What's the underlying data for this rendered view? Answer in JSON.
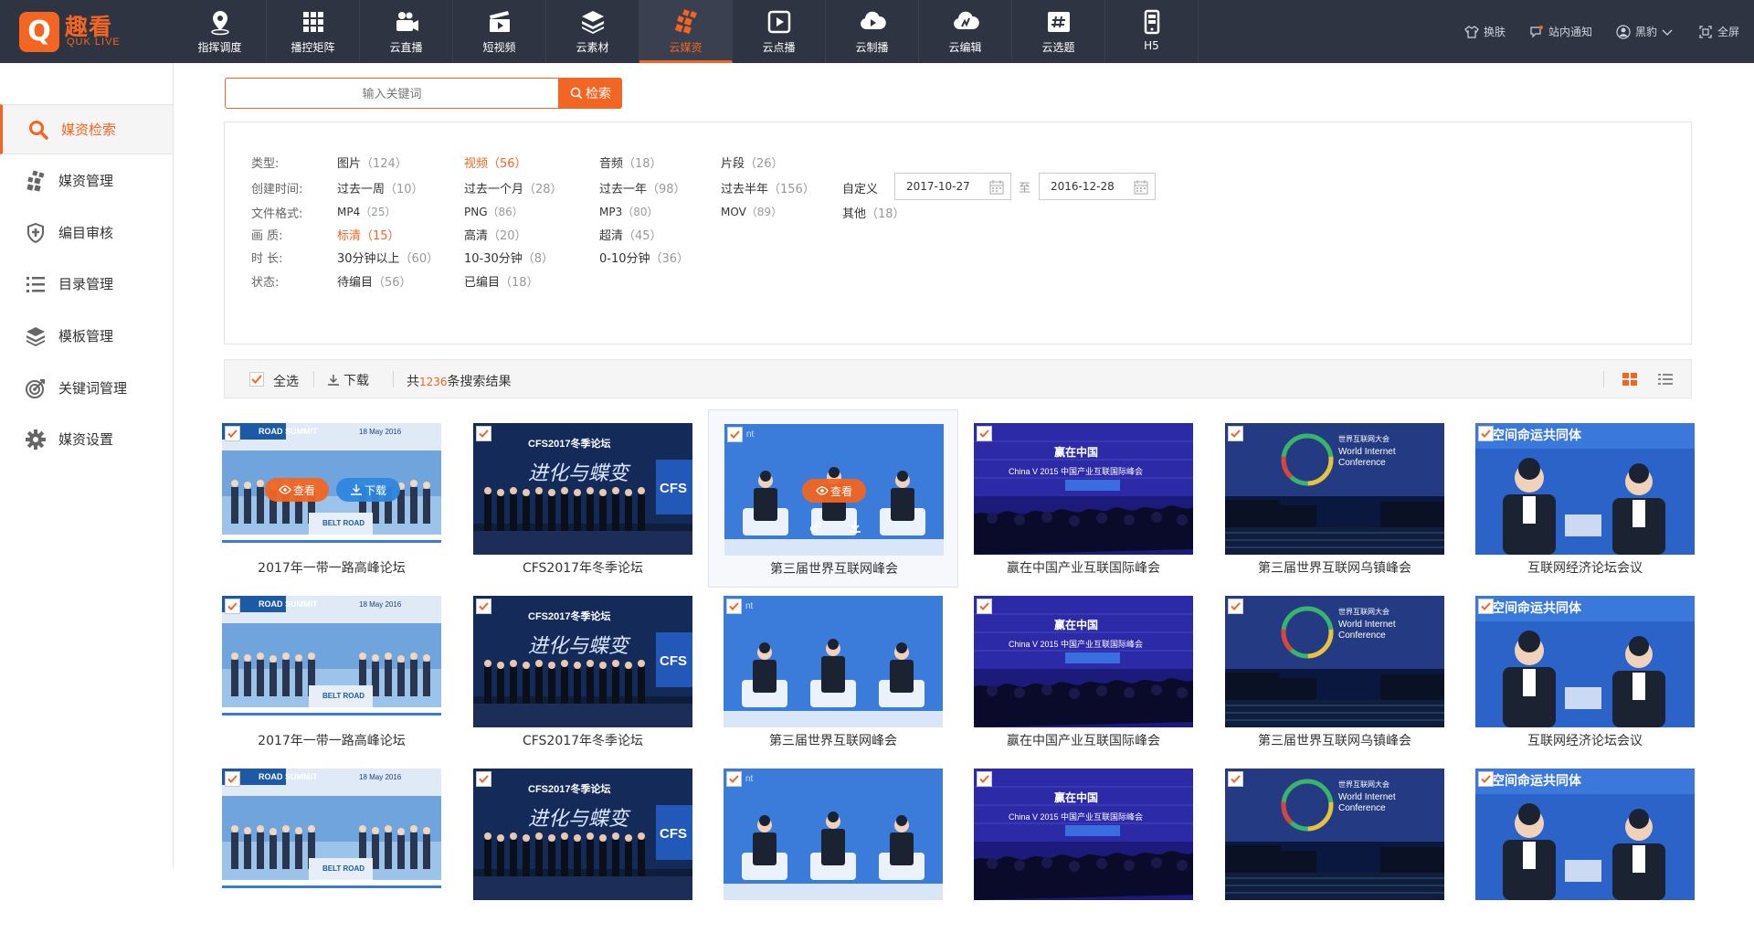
{
  "brand": {
    "logo_glyph": "Q",
    "name_cn": "趣看",
    "name_en": "QUK LIVE",
    "color": "#f26522"
  },
  "nav": [
    {
      "label": "指挥调度",
      "icon": "location-pin-icon"
    },
    {
      "label": "播控矩阵",
      "icon": "grid-icon"
    },
    {
      "label": "云直播",
      "icon": "camera-icon"
    },
    {
      "label": "短视频",
      "icon": "clapperboard-icon"
    },
    {
      "label": "云素材",
      "icon": "layers-icon"
    },
    {
      "label": "云媒资",
      "icon": "media-cubes-icon",
      "active": true
    },
    {
      "label": "云点播",
      "icon": "play-icon"
    },
    {
      "label": "云制播",
      "icon": "cloud-play-icon"
    },
    {
      "label": "云编辑",
      "icon": "cloud-edit-icon"
    },
    {
      "label": "云选题",
      "icon": "hashtag-icon"
    },
    {
      "label": "H5",
      "icon": "mobile-icon"
    }
  ],
  "top_right": {
    "skin": "换肤",
    "notice": "站内通知",
    "user": "黑豹",
    "fullscreen": "全屏"
  },
  "sidebar": [
    {
      "label": "媒资检索",
      "icon": "search-icon",
      "active": true
    },
    {
      "label": "媒资管理",
      "icon": "media-manage-icon"
    },
    {
      "label": "编目审核",
      "icon": "shield-icon"
    },
    {
      "label": "目录管理",
      "icon": "list-icon"
    },
    {
      "label": "模板管理",
      "icon": "layers-icon"
    },
    {
      "label": "关键词管理",
      "icon": "target-icon"
    },
    {
      "label": "媒资设置",
      "icon": "gear-icon"
    }
  ],
  "search": {
    "placeholder": "输入关键词",
    "button": "检索"
  },
  "filters": {
    "type_label": "类型:",
    "type_opts": [
      {
        "name": "图片",
        "count": "（124）"
      },
      {
        "name": "视频",
        "count": "（56）",
        "selected": true
      },
      {
        "name": "音频",
        "count": "（18）"
      },
      {
        "name": "片段",
        "count": "（26）"
      }
    ],
    "time_label": "创建时间:",
    "time_opts": [
      {
        "name": "过去一周",
        "count": "（10）"
      },
      {
        "name": "过去一个月",
        "count": "（28）"
      },
      {
        "name": "过去一年",
        "count": "（98）"
      },
      {
        "name": "过去半年",
        "count": "（156）"
      },
      {
        "name": "自定义",
        "count": ""
      }
    ],
    "date_from": "2017-10-27",
    "date_sep": "至",
    "date_to": "2016-12-28",
    "format_label": "文件格式:",
    "format_opts": [
      {
        "name": "MP4",
        "count": "（25）"
      },
      {
        "name": "PNG",
        "count": "（86）"
      },
      {
        "name": "MP3",
        "count": "（80）"
      },
      {
        "name": "MOV",
        "count": "（89）"
      },
      {
        "name": "其他",
        "count": "（18）"
      }
    ],
    "quality_label": "画 质:",
    "quality_opts": [
      {
        "name": "标清",
        "count": "（15）",
        "selected": true
      },
      {
        "name": "高清",
        "count": "（20）"
      },
      {
        "name": "超清",
        "count": "（45）"
      }
    ],
    "duration_label": "时 长:",
    "duration_opts": [
      {
        "name": "30分钟以上",
        "count": "（60）"
      },
      {
        "name": "10-30分钟",
        "count": "（8）"
      },
      {
        "name": "0-10分钟",
        "count": "（36）"
      }
    ],
    "status_label": "状态:",
    "status_opts": [
      {
        "name": "待编目",
        "count": "（56）"
      },
      {
        "name": "已编目",
        "count": "（18）"
      }
    ]
  },
  "toolbar": {
    "select_all": "全选",
    "download": "下载",
    "count_prefix": "共",
    "count": "1236",
    "count_suffix": "条搜索结果"
  },
  "overlay": {
    "view": "查看",
    "download": "下载"
  },
  "thumb_texts": {
    "t1_head": "ROAD SUMMIT",
    "t1_date": "18 May 2016",
    "t1_banner": "BELT ROAD",
    "t2_head": "CFS2017冬季论坛",
    "t2_brand": "CFS",
    "t2_slogan": "进化与蝶变",
    "t3_tag": "nt",
    "t4_head": "赢在中国",
    "t4_sub": "China V 2015 中国产业互联国际峰会",
    "t5_cn": "世界互联网大会",
    "t5_en1": "World Internet",
    "t5_en2": "Conference",
    "t6_head": "空间命运共同体"
  },
  "items": [
    {
      "title": "2017年一带一路高峰论坛",
      "thumb": "summit"
    },
    {
      "title": "CFS2017年冬季论坛",
      "thumb": "cfs"
    },
    {
      "title": "第三届世界互联网峰会",
      "thumb": "stage"
    },
    {
      "title": "赢在中国产业互联国际峰会",
      "thumb": "china"
    },
    {
      "title": "第三届世界互联网乌镇峰会",
      "thumb": "wuzhen"
    },
    {
      "title": "互联网经济论坛会议",
      "thumb": "forum"
    },
    {
      "title": "2017年一带一路高峰论坛",
      "thumb": "summit"
    },
    {
      "title": "CFS2017年冬季论坛",
      "thumb": "cfs"
    },
    {
      "title": "第三届世界互联网峰会",
      "thumb": "stage"
    },
    {
      "title": "赢在中国产业互联国际峰会",
      "thumb": "china"
    },
    {
      "title": "第三届世界互联网乌镇峰会",
      "thumb": "wuzhen"
    },
    {
      "title": "互联网经济论坛会议",
      "thumb": "forum"
    },
    {
      "title": "",
      "thumb": "summit"
    },
    {
      "title": "",
      "thumb": "cfs"
    },
    {
      "title": "",
      "thumb": "stage"
    },
    {
      "title": "",
      "thumb": "china"
    },
    {
      "title": "",
      "thumb": "wuzhen"
    },
    {
      "title": "",
      "thumb": "forum"
    }
  ],
  "colors": {
    "accent": "#f26522",
    "topbar": "#2f3442",
    "download_blue": "#2e86de"
  }
}
